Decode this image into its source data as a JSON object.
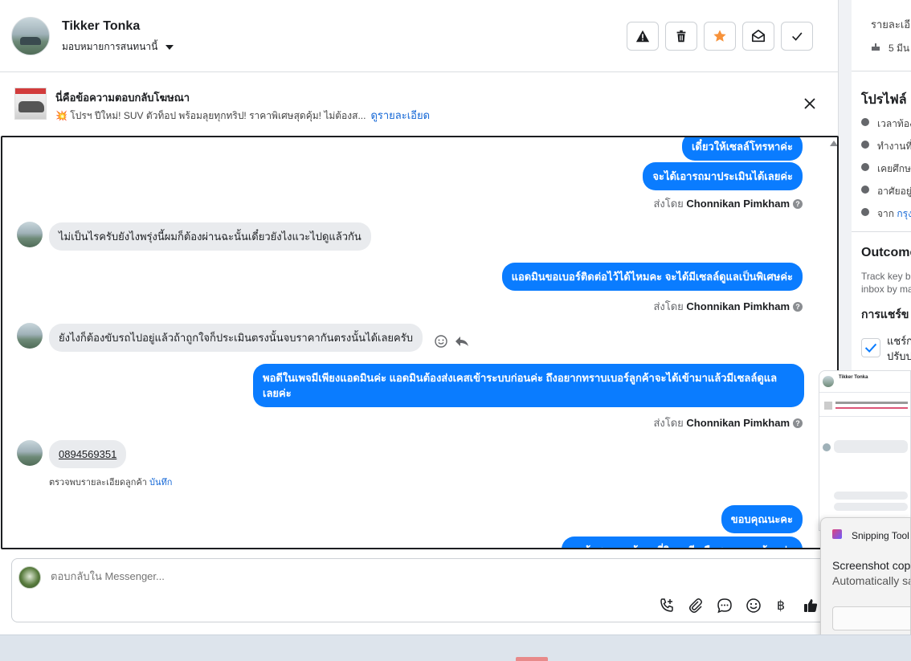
{
  "header": {
    "contact_name": "Tikker Tonka",
    "assign_label": "มอบหมายการสนทนานี้"
  },
  "ad": {
    "title": "นี่คือข้อความตอบกลับโฆษณา",
    "description": "💥 โปรฯ ปีใหม่! SUV ตัวท็อป พร้อมลุยทุกทริป! ราคาพิเศษสุดคุ้ม! ไม่ต้องส...",
    "link": "ดูรายละเอียด"
  },
  "messages": {
    "m1": "เดี๋ยวให้เซลล์โทรหาค่ะ",
    "m2": "จะได้เอารถมาประเมินได้เลยค่ะ",
    "sent_prefix": "ส่งโดย",
    "agent": "Chonnikan Pimkham",
    "m3": "ไม่เป็นไรครับยังไงพรุ่งนี้ผมก็ต้องผ่านฉะนั้นเดี๋ยวยังไงแวะไปดูแล้วกัน",
    "m4": "แอดมินขอเบอร์ติดต่อไว้ได้ไหมคะ จะได้มีเซลล์ดูแลเป็นพิเศษค่ะ",
    "m5": "ยังไงก็ต้องขับรถไปอยู่แล้วถ้าถูกใจก็ประเมินตรงนั้นจบราคากันตรงนั้นได้เลยครับ",
    "m6_line1": "พอดีในเพจมีเพียงแอดมินค่ะ แอดมินต้องส่งเคสเข้าระบบก่อนค่ะ ถึงอยากทราบเบอร์ลูกค้าจะได้เข้ามาแล้วมีเซลล์ดูแล",
    "m6_line2": "เลยค่ะ",
    "m7": "0894569351",
    "detected": "ตรวจพบรายละเอียดลูกค้า",
    "save_link": "บันทึก",
    "m8": "ขอบคุณนะคะ",
    "m9": "ลูกค้าสะดวกเข้ามาที่วิภาวดี หรือสาขาแถวบ้านค่ะ"
  },
  "composer": {
    "placeholder": "ตอบกลับใน Messenger..."
  },
  "right_panel": {
    "r1": "รายละเอี",
    "r2": "5 มีน",
    "profile_title": "โปรไฟล์",
    "p1": "เวลาท้อง",
    "p2": "ทำงานที่",
    "p3": "เคยศึกษ",
    "p4": "อาศัยอยู่",
    "p5_prefix": "จาก ",
    "p5_link": "กรุง",
    "outcome_title": "Outcome",
    "outcome_desc1": "Track key b",
    "outcome_desc2": "inbox by ma",
    "share_title": "การแชร์ข",
    "share_1": "แชร์ก",
    "share_2": "ปรับป"
  },
  "mini_preview": {
    "name": "Tikker Tonka"
  },
  "snipping": {
    "title": "Snipping Tool",
    "line1": "Screenshot copi",
    "line2": "Automatically sa"
  },
  "colors": {
    "accent": "#0a7cff",
    "link": "#1467d6",
    "star": "#f7923a"
  }
}
